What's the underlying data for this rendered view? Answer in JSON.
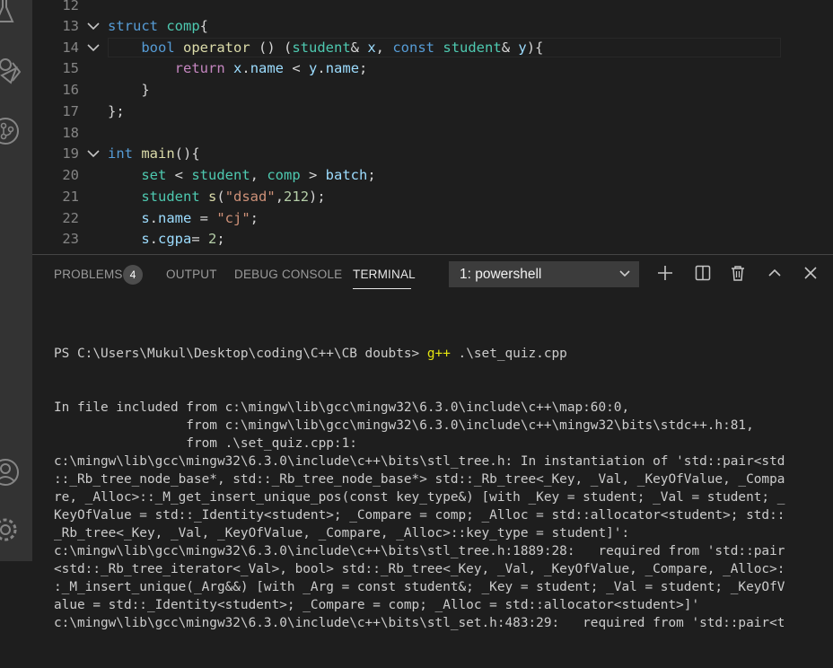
{
  "activity_bar": {
    "icons": [
      "flask-icon",
      "run-debug-icon",
      "source-control-icon",
      "account-icon",
      "settings-gear-icon"
    ]
  },
  "editor": {
    "lines": [
      {
        "num": "12",
        "fold": false,
        "tokens": []
      },
      {
        "num": "13",
        "fold": true,
        "tokens": [
          {
            "t": "struct",
            "c": "kw"
          },
          {
            "t": " ",
            "c": "pun"
          },
          {
            "t": "comp",
            "c": "ty"
          },
          {
            "t": "{",
            "c": "pun"
          }
        ]
      },
      {
        "num": "14",
        "fold": true,
        "tokens": [
          {
            "t": "    ",
            "c": "pun"
          },
          {
            "t": "bool",
            "c": "kw"
          },
          {
            "t": " ",
            "c": "pun"
          },
          {
            "t": "operator",
            "c": "fn"
          },
          {
            "t": " () (",
            "c": "pun"
          },
          {
            "t": "student",
            "c": "ty"
          },
          {
            "t": "& ",
            "c": "pun"
          },
          {
            "t": "x",
            "c": "var"
          },
          {
            "t": ", ",
            "c": "pun"
          },
          {
            "t": "const",
            "c": "kw"
          },
          {
            "t": " ",
            "c": "pun"
          },
          {
            "t": "student",
            "c": "ty"
          },
          {
            "t": "& ",
            "c": "pun"
          },
          {
            "t": "y",
            "c": "var"
          },
          {
            "t": "){",
            "c": "pun"
          }
        ]
      },
      {
        "num": "15",
        "fold": false,
        "tokens": [
          {
            "t": "        ",
            "c": "pun"
          },
          {
            "t": "return",
            "c": "ctl"
          },
          {
            "t": " ",
            "c": "pun"
          },
          {
            "t": "x",
            "c": "var"
          },
          {
            "t": ".",
            "c": "pun"
          },
          {
            "t": "name",
            "c": "var"
          },
          {
            "t": " < ",
            "c": "pun"
          },
          {
            "t": "y",
            "c": "var"
          },
          {
            "t": ".",
            "c": "pun"
          },
          {
            "t": "name",
            "c": "var"
          },
          {
            "t": ";",
            "c": "pun"
          }
        ]
      },
      {
        "num": "16",
        "fold": false,
        "tokens": [
          {
            "t": "    ",
            "c": "pun"
          },
          {
            "t": "}",
            "c": "pun"
          }
        ]
      },
      {
        "num": "17",
        "fold": false,
        "tokens": [
          {
            "t": "};",
            "c": "pun"
          }
        ]
      },
      {
        "num": "18",
        "fold": false,
        "tokens": []
      },
      {
        "num": "19",
        "fold": true,
        "tokens": [
          {
            "t": "int",
            "c": "kw"
          },
          {
            "t": " ",
            "c": "pun"
          },
          {
            "t": "main",
            "c": "fn"
          },
          {
            "t": "(){",
            "c": "pun"
          }
        ]
      },
      {
        "num": "20",
        "fold": false,
        "tokens": [
          {
            "t": "    ",
            "c": "pun"
          },
          {
            "t": "set",
            "c": "ty"
          },
          {
            "t": " < ",
            "c": "pun"
          },
          {
            "t": "student",
            "c": "ty"
          },
          {
            "t": ", ",
            "c": "pun"
          },
          {
            "t": "comp",
            "c": "ty"
          },
          {
            "t": " > ",
            "c": "pun"
          },
          {
            "t": "batch",
            "c": "var"
          },
          {
            "t": ";",
            "c": "pun"
          }
        ]
      },
      {
        "num": "21",
        "fold": false,
        "tokens": [
          {
            "t": "    ",
            "c": "pun"
          },
          {
            "t": "student",
            "c": "ty"
          },
          {
            "t": " ",
            "c": "pun"
          },
          {
            "t": "s",
            "c": "fn"
          },
          {
            "t": "(",
            "c": "pun"
          },
          {
            "t": "\"dsad\"",
            "c": "str"
          },
          {
            "t": ",",
            "c": "pun"
          },
          {
            "t": "212",
            "c": "num"
          },
          {
            "t": ");",
            "c": "pun"
          }
        ]
      },
      {
        "num": "22",
        "fold": false,
        "tokens": [
          {
            "t": "    ",
            "c": "pun"
          },
          {
            "t": "s",
            "c": "var"
          },
          {
            "t": ".",
            "c": "pun"
          },
          {
            "t": "name",
            "c": "var"
          },
          {
            "t": " = ",
            "c": "pun"
          },
          {
            "t": "\"cj\"",
            "c": "str"
          },
          {
            "t": ";",
            "c": "pun"
          }
        ]
      },
      {
        "num": "23",
        "fold": false,
        "tokens": [
          {
            "t": "    ",
            "c": "pun"
          },
          {
            "t": "s",
            "c": "var"
          },
          {
            "t": ".",
            "c": "pun"
          },
          {
            "t": "cgpa",
            "c": "var"
          },
          {
            "t": "= ",
            "c": "pun"
          },
          {
            "t": "2",
            "c": "num"
          },
          {
            "t": ";",
            "c": "pun"
          }
        ]
      }
    ]
  },
  "panel": {
    "tabs": {
      "problems": "PROBLEMS",
      "problems_count": "4",
      "output": "OUTPUT",
      "debug_console": "DEBUG CONSOLE",
      "terminal": "TERMINAL"
    },
    "active_tab": "TERMINAL",
    "terminal_select": "1: powershell",
    "actions": [
      "plus-icon",
      "split-icon",
      "trash-icon",
      "chevron-up-icon",
      "close-icon"
    ]
  },
  "terminal": {
    "prompt": "PS C:\\Users\\Mukul\\Desktop\\coding\\C++\\CB doubts> ",
    "command": "g++",
    "command_args": " .\\set_quiz.cpp",
    "lines": [
      "In file included from c:\\mingw\\lib\\gcc\\mingw32\\6.3.0\\include\\c++\\map:60:0,",
      "                 from c:\\mingw\\lib\\gcc\\mingw32\\6.3.0\\include\\c++\\mingw32\\bits\\stdc++.h:81,",
      "                 from .\\set_quiz.cpp:1:",
      "c:\\mingw\\lib\\gcc\\mingw32\\6.3.0\\include\\c++\\bits\\stl_tree.h: In instantiation of 'std::pair<std",
      "::_Rb_tree_node_base*, std::_Rb_tree_node_base*> std::_Rb_tree<_Key, _Val, _KeyOfValue, _Compa",
      "re, _Alloc>::_M_get_insert_unique_pos(const key_type&) [with _Key = student; _Val = student; _",
      "KeyOfValue = std::_Identity<student>; _Compare = comp; _Alloc = std::allocator<student>; std::",
      "_Rb_tree<_Key, _Val, _KeyOfValue, _Compare, _Alloc>::key_type = student]':",
      "c:\\mingw\\lib\\gcc\\mingw32\\6.3.0\\include\\c++\\bits\\stl_tree.h:1889:28:   required from 'std::pair",
      "<std::_Rb_tree_iterator<_Val>, bool> std::_Rb_tree<_Key, _Val, _KeyOfValue, _Compare, _Alloc>:",
      ":_M_insert_unique(_Arg&&) [with _Arg = const student&; _Key = student; _Val = student; _KeyOfV",
      "alue = std::_Identity<student>; _Compare = comp; _Alloc = std::allocator<student>]'",
      "c:\\mingw\\lib\\gcc\\mingw32\\6.3.0\\include\\c++\\bits\\stl_set.h:483:29:   required from 'std::pair<t"
    ]
  },
  "colors": {
    "editor_bg": "#1e1e1e",
    "activity_bg": "#333333",
    "keyword": "#569cd6",
    "type": "#4ec9b0",
    "function": "#dcdcaa",
    "variable": "#9cdcfe",
    "string": "#ce9178",
    "number": "#b5cea8",
    "control": "#c586c0",
    "terminal_command": "#e5e510"
  }
}
